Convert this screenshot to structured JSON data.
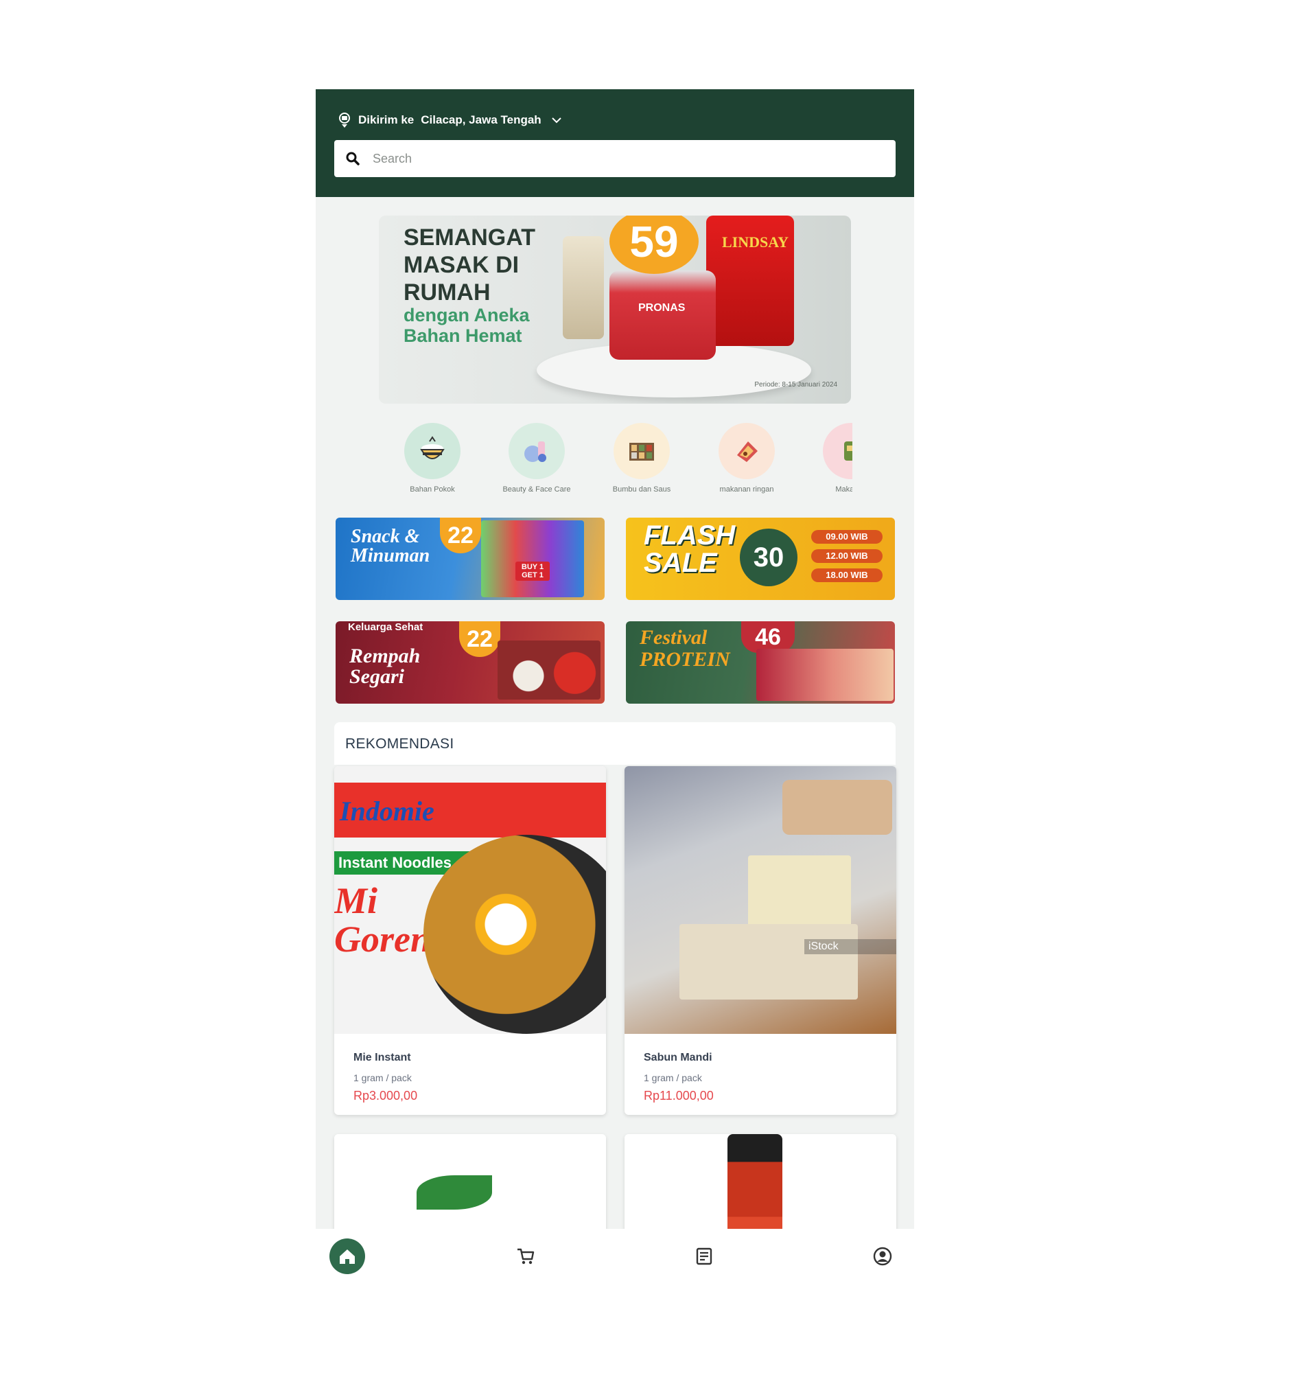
{
  "header": {
    "deliver_prefix": "Dikirim ke",
    "deliver_location": "Cilacap, Jawa Tengah",
    "search_placeholder": "Search"
  },
  "hero_banner": {
    "headline": "SEMANGAT MASAK DI RUMAH",
    "subline": "dengan Aneka Bahan Hemat",
    "badge": "59",
    "brand_left": "PRONAS",
    "brand_right": "LINDSAY",
    "fineprint": "Periode: 8-15 Januari 2024"
  },
  "categories": [
    {
      "label": "Bahan Pokok",
      "color": "#cfe9dc",
      "icon": "rice-bowl-icon"
    },
    {
      "label": "Beauty & Face Care",
      "color": "#d9ede2",
      "icon": "cosmetics-icon"
    },
    {
      "label": "Bumbu dan Saus",
      "color": "#fbeed6",
      "icon": "spice-rack-icon"
    },
    {
      "label": "makanan ringan",
      "color": "#fbe6d8",
      "icon": "snack-icon"
    },
    {
      "label": "Makanan",
      "color": "#f9d8dc",
      "icon": "food-icon"
    }
  ],
  "promos": [
    {
      "title": "Snack & Minuman",
      "badge": "22",
      "tag": "BUY 1 GET 1",
      "colors": [
        "#1f74c7",
        "#f0b042"
      ]
    },
    {
      "title": "FLASH SALE",
      "badge": "30",
      "times": [
        "09.00 WIB",
        "12.00 WIB",
        "18.00 WIB"
      ],
      "colors": [
        "#f6c21c",
        "#f0a91a"
      ]
    },
    {
      "title": "Rempah Segari",
      "subtitle": "Keluarga Sehat",
      "badge": "22",
      "colors": [
        "#8b1d2c",
        "#c43a3a"
      ]
    },
    {
      "title": "Festival PROTEIN",
      "badge": "46",
      "colors": [
        "#2f5e3f",
        "#c84848"
      ]
    }
  ],
  "recommendation": {
    "title": "REKOMENDASI",
    "products": [
      {
        "name": "Mie Instant",
        "unit": "1 gram / pack",
        "price": "Rp3.000,00",
        "image_brand": "Indomie",
        "image_tag": "Instant Noodles",
        "image_title": "Mi Goreng"
      },
      {
        "name": "Sabun Mandi",
        "unit": "1 gram / pack",
        "price": "Rp11.000,00",
        "image_watermark": "iStock"
      },
      {
        "name": "",
        "unit": "",
        "price": ""
      },
      {
        "name": "",
        "unit": "",
        "price": ""
      }
    ]
  },
  "bottom_nav": [
    {
      "name": "home",
      "icon": "home-icon",
      "active": true
    },
    {
      "name": "cart",
      "icon": "cart-icon",
      "active": false
    },
    {
      "name": "orders",
      "icon": "receipt-icon",
      "active": false
    },
    {
      "name": "profile",
      "icon": "profile-icon",
      "active": false
    }
  ],
  "colors": {
    "header_bg": "#1e4232",
    "page_bg": "#f1f3f2",
    "price": "#e5484d",
    "nav_active": "#2f6b4c"
  }
}
